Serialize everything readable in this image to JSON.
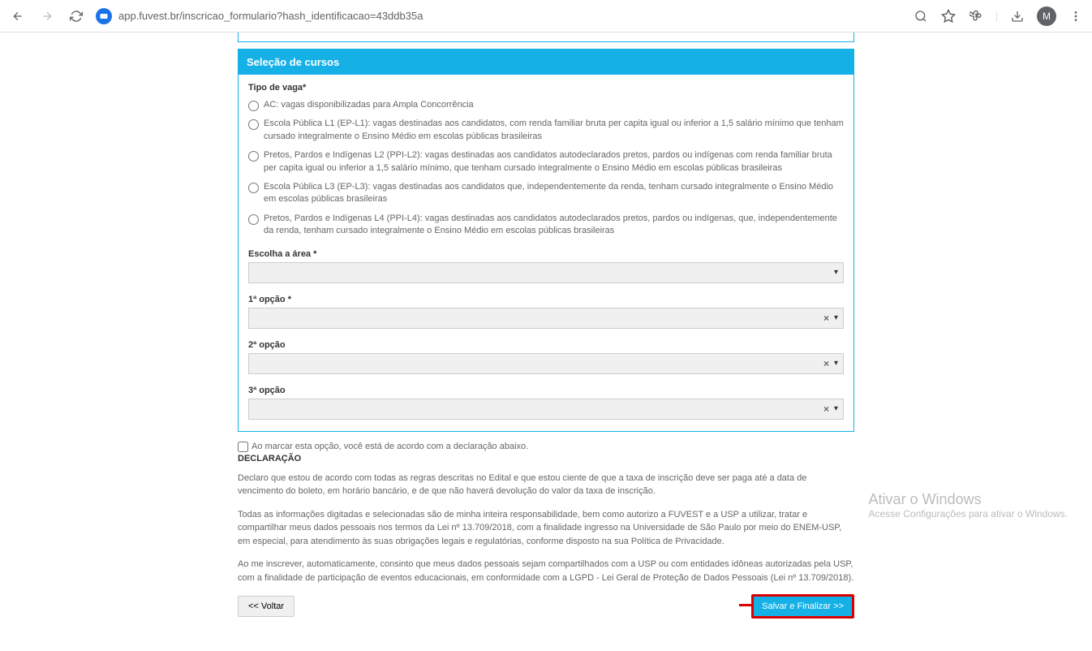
{
  "browser": {
    "url": "app.fuvest.br/inscricao_formulario?hash_identificacao=43ddb35a",
    "avatar_letter": "M"
  },
  "panel": {
    "title": "Seleção de cursos",
    "tipo_vaga_label": "Tipo de vaga*",
    "radios": [
      "AC: vagas disponibilizadas para Ampla Concorrência",
      "Escola Pública L1 (EP-L1): vagas destinadas aos candidatos, com renda familiar bruta per capita igual ou inferior a 1,5 salário mínimo que tenham cursado integralmente o Ensino Médio em escolas públicas brasileiras",
      "Pretos, Pardos e Indígenas L2 (PPI-L2): vagas destinadas aos candidatos autodeclarados pretos, pardos ou indígenas com renda familiar bruta per capita igual ou inferior a 1,5 salário mínimo, que tenham cursado integralmente o Ensino Médio em escolas públicas brasileiras",
      "Escola Pública L3 (EP-L3): vagas destinadas aos candidatos que, independentemente da renda, tenham cursado integralmente o Ensino Médio em escolas públicas brasileiras",
      "Pretos, Pardos e Indígenas L4 (PPI-L4): vagas destinadas aos candidatos autodeclarados pretos, pardos ou indígenas, que, independentemente da renda, tenham cursado integralmente o Ensino Médio em escolas públicas brasileiras"
    ],
    "area_label": "Escolha a área *",
    "opcao1_label": "1ª opção *",
    "opcao2_label": "2ª opção",
    "opcao3_label": "3ª opção"
  },
  "declaration": {
    "checkbox_label": "Ao marcar esta opção, você está de acordo com a declaração abaixo.",
    "title": "DECLARAÇÃO",
    "p1": "Declaro que estou de acordo com todas as regras descritas no Edital e que estou ciente de que a taxa de inscrição deve ser paga até a data de vencimento do boleto, em horário bancário, e de que não haverá devolução do valor da taxa de inscrição.",
    "p2": "Todas as informações digitadas e selecionadas são de minha inteira responsabilidade, bem como autorizo a FUVEST e a USP a utilizar, tratar e compartilhar meus dados pessoais nos termos da Lei nº 13.709/2018, com a finalidade ingresso na Universidade de São Paulo por meio do ENEM-USP, em especial, para atendimento às suas obrigações legais e regulatórias, conforme disposto na sua Política de Privacidade.",
    "p3": "Ao me inscrever, automaticamente, consinto que meus dados pessoais sejam compartilhados com a USP ou com entidades idôneas autorizadas pela USP, com a finalidade de participação de eventos educacionais, em conformidade com a LGPD - Lei Geral de Proteção de Dados Pessoais (Lei nº 13.709/2018)."
  },
  "buttons": {
    "back": "<< Voltar",
    "submit": "Salvar e Finalizar >>"
  },
  "watermark": {
    "line1": "Ativar o Windows",
    "line2": "Acesse Configurações para ativar o Windows."
  }
}
